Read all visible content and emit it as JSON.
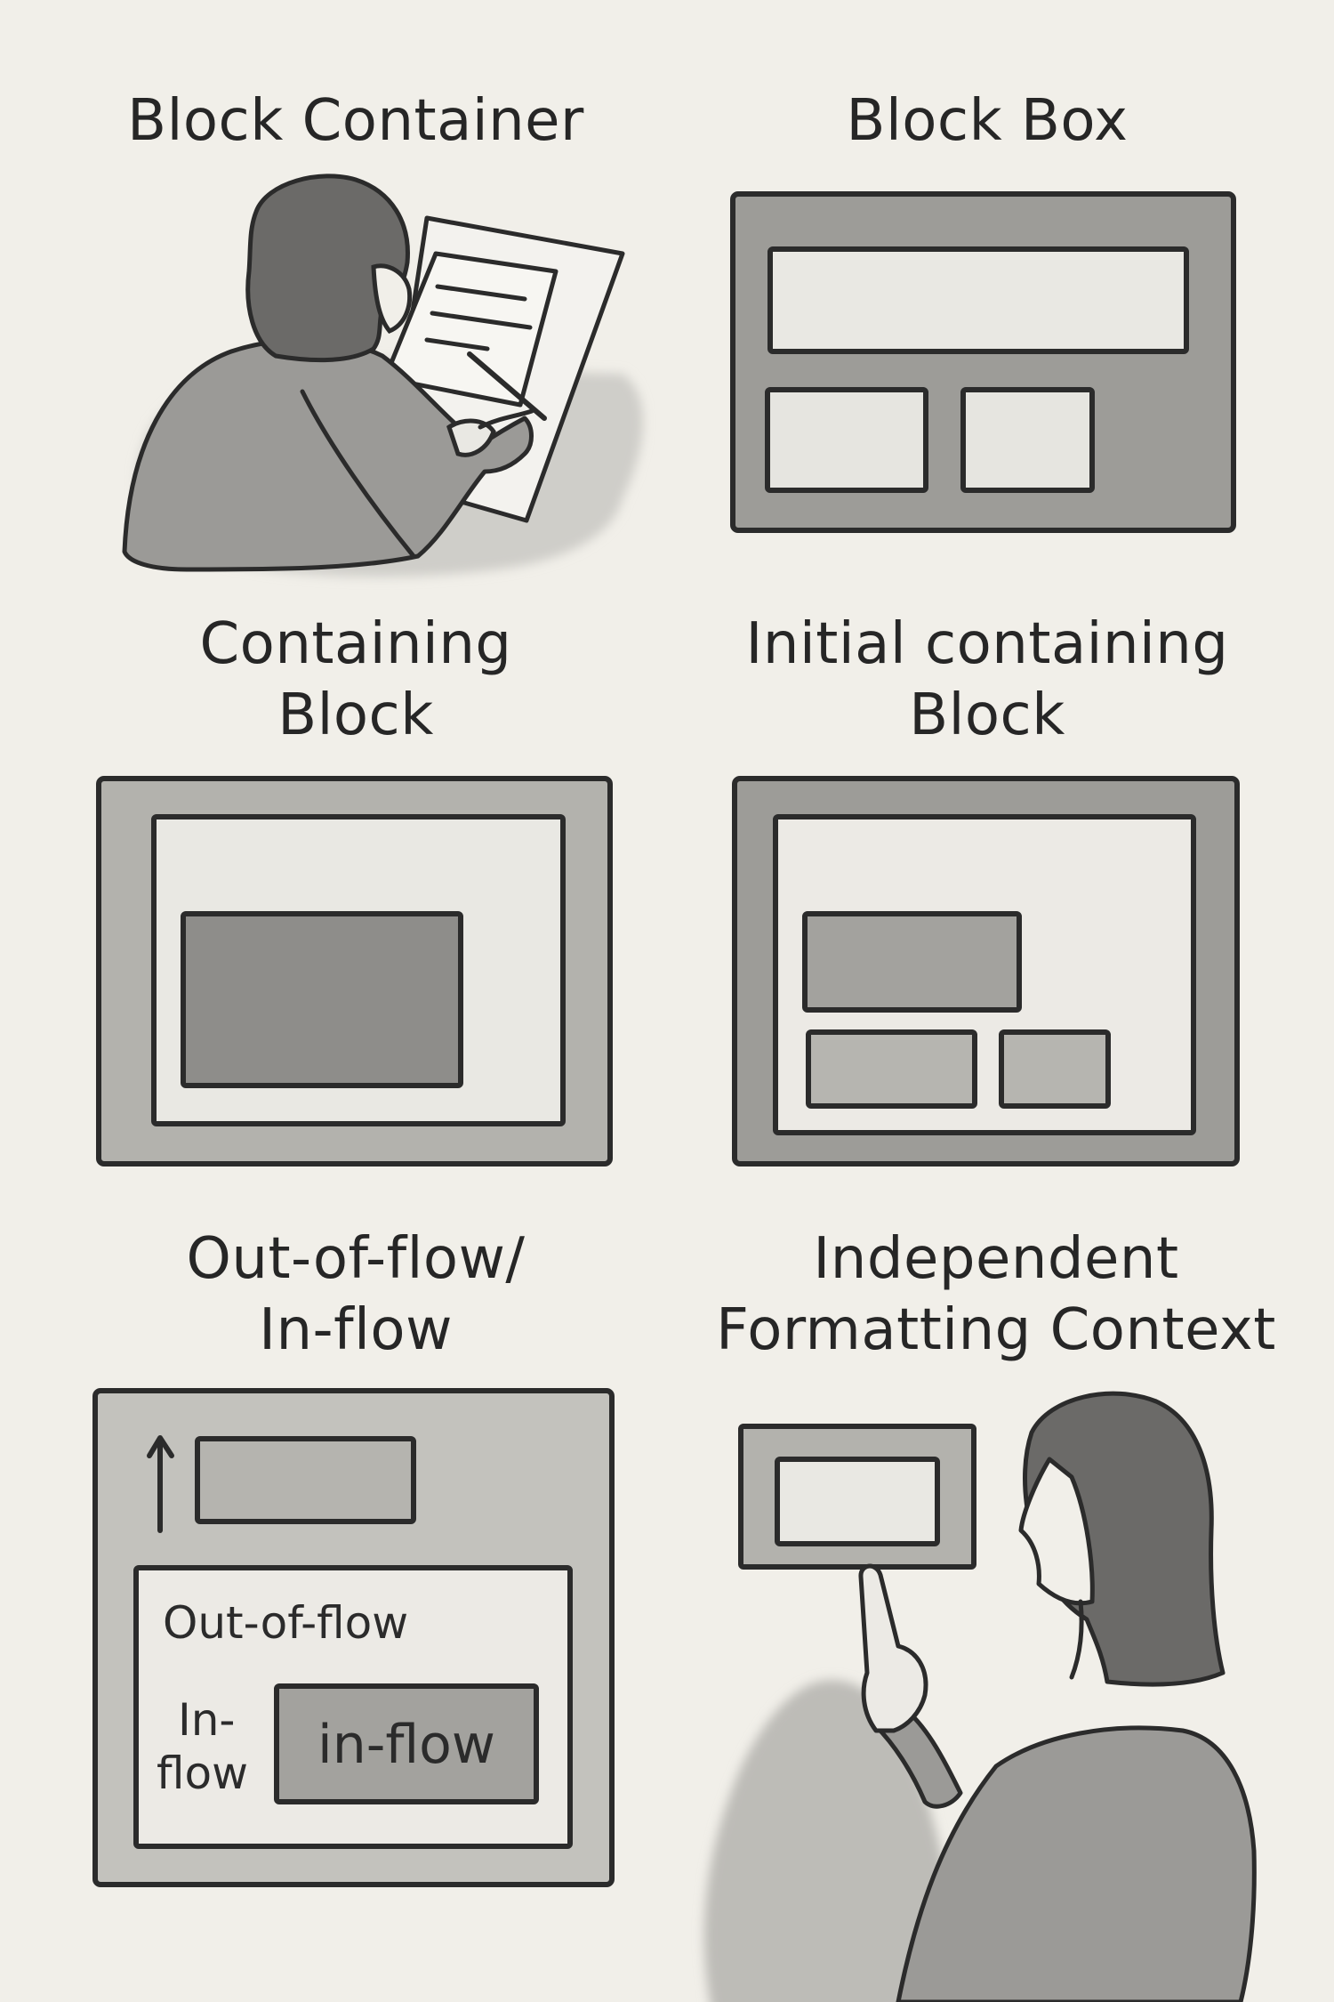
{
  "panels": {
    "block_container": {
      "title": "Block Container"
    },
    "block_box": {
      "title": "Block Box"
    },
    "containing_block": {
      "title_line1": "Containing",
      "title_line2": "Block"
    },
    "initial_containing_block": {
      "title_line1": "Initial containing",
      "title_line2": "Block"
    },
    "flow": {
      "title_line1": "Out-of-flow/",
      "title_line2": "In-flow",
      "label_out_of_flow": "Out-of-flow",
      "label_in_flow_left_1": "In-",
      "label_in_flow_left_2": "flow",
      "label_in_flow_box": "in-flow"
    },
    "independent_formatting_context": {
      "title_line1": "Independent",
      "title_line2": "Formatting Context"
    }
  },
  "colors": {
    "paper": "#f1efe9",
    "ink": "#2b2b2b",
    "wash_dark": "#8f8f8c",
    "wash_mid": "#b4b3ae",
    "wash_light": "#d6d5d0",
    "wash_pale": "#e7e6e1"
  }
}
